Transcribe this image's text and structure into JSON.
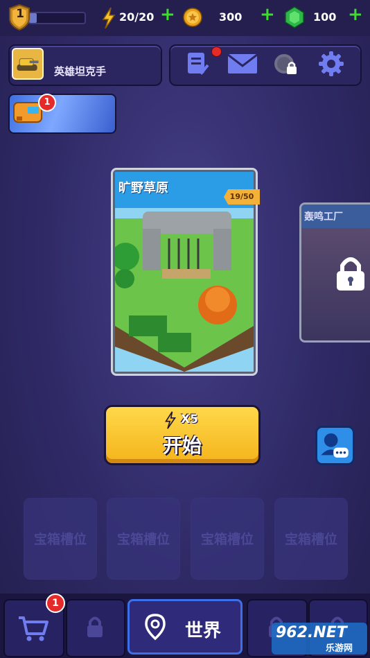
{
  "top": {
    "level": "1",
    "energy": "20/20",
    "coins": "300",
    "gems": "100"
  },
  "player": {
    "name": "英雄坦克手"
  },
  "event_badge": "1",
  "stage": {
    "title": "旷野草原",
    "progress_text": "19/50",
    "next_title": "轰鸣工厂"
  },
  "start": {
    "cost": "X5",
    "label": "开始"
  },
  "chest_slots": [
    "宝箱槽位",
    "宝箱槽位",
    "宝箱槽位",
    "宝箱槽位"
  ],
  "nav": {
    "shop_badge": "1",
    "world_label": "世界"
  },
  "watermark": {
    "main": "962.NET",
    "sub": "乐游网"
  },
  "colors": {
    "accent_yellow": "#f7c325",
    "bg": "#2f2a66",
    "plus_green": "#3fdc2f"
  },
  "icons": [
    "level-shield-icon",
    "lightning-icon",
    "coin-icon",
    "gem-icon",
    "quest-icon",
    "mail-icon",
    "clock-lock-icon",
    "gear-icon",
    "cart-icon",
    "lock-icon",
    "map-pin-icon",
    "support-chat-icon"
  ]
}
